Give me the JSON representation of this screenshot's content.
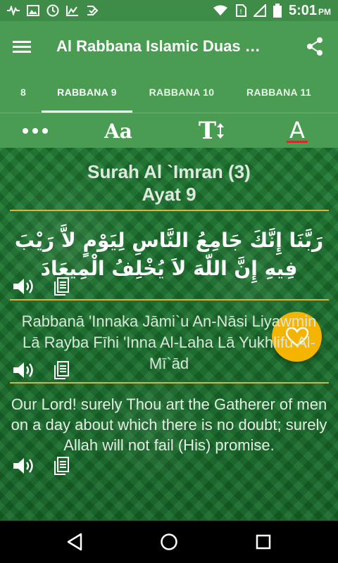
{
  "status_bar": {
    "time": "5:01",
    "ampm": "PM",
    "icons": [
      "activity-icon",
      "image-icon",
      "clock-icon",
      "chart-icon",
      "check-icon",
      "wifi-icon",
      "no-sim-icon",
      "signal-icon",
      "battery-icon"
    ]
  },
  "app_bar": {
    "title": "Al Rabbana Islamic Duas Dua'a",
    "menu_icon": "hamburger-menu-icon",
    "share_icon": "share-icon"
  },
  "tabs": [
    {
      "label": "8"
    },
    {
      "label": "RABBANA 9"
    },
    {
      "label": "RABBANA 10"
    },
    {
      "label": "RABBANA 11"
    }
  ],
  "toolbar": {
    "more_icon": "more-dots-icon",
    "font_label": "Aa",
    "size_label": "T",
    "color_label": "A"
  },
  "content": {
    "surah_line1": "Surah Al `Imran (3)",
    "surah_line2": "Ayat 9",
    "arabic": "رَبَّنَا إِنَّكَ جَامِعُ النَّاسِ لِيَوْمٍ لاَّ رَيْبَ فِيهِ إِنَّ اللّهَ لاَ يُخْلِفُ الْمِيعَادَ",
    "transliteration": "Rabbanā 'Innaka Jāmi`u An-Nāsi Liyawmin Lā Rayba Fīhi 'Inna Al-Laha Lā Yukhlifu Al-Mī`ād",
    "translation": "Our Lord! surely Thou art the Gatherer of men on a day about which there is no doubt; surely Allah will not fail (His) promise."
  },
  "colors": {
    "status_bar": "#3e8c47",
    "app_bar": "#4a9c52",
    "background": "#1e6e2c",
    "divider": "#d7b43c",
    "fab": "#f4b400"
  },
  "nav_icons": [
    "back-icon",
    "home-icon",
    "recents-icon"
  ]
}
